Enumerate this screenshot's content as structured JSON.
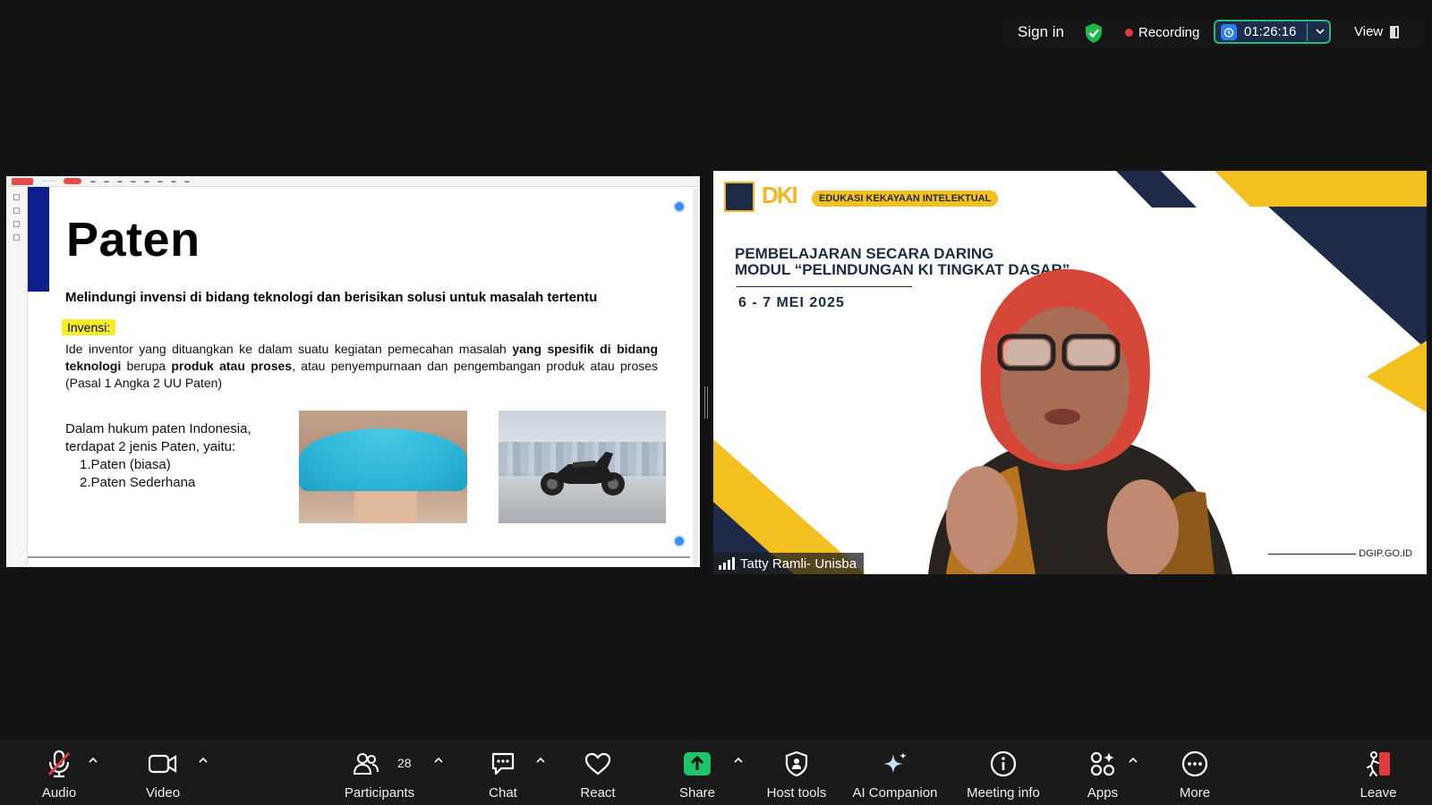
{
  "top_bar": {
    "sign_in": "Sign in",
    "recording_label": "Recording",
    "timer": "01:26:16",
    "view_label": "View"
  },
  "shared_slide": {
    "title": "Paten",
    "subtitle": "Melindungi invensi di bidang teknologi dan berisikan solusi untuk masalah tertentu",
    "highlight_label": "Invensi:",
    "paragraph_parts": [
      "Ide inventor yang dituangkan ke dalam suatu kegiatan pemecahan masalah ",
      "yang spesifik di bidang teknologi",
      " berupa ",
      "produk atau proses",
      ", atau penyempurnaan dan pengembangan produk atau proses (Pasal 1 Angka 2 UU Paten)"
    ],
    "list_intro": "Dalam hukum paten Indonesia, terdapat 2 jenis Paten, yaitu:",
    "list_items": [
      "1.Paten (biasa)",
      "2.Paten Sederhana"
    ]
  },
  "video": {
    "badge": "EDUKASI KEKAYAAN INTELEKTUAL",
    "logo_text": "DKI",
    "heading_line1": "PEMBELAJARAN SECARA DARING",
    "heading_line2": "MODUL “PELINDUNGAN KI TINGKAT DASAR”",
    "date": "6 - 7 MEI 2025",
    "site": "DGIP.GO.ID",
    "participant_name": "Tatty Ramli- Unisba"
  },
  "toolbar": {
    "audio": "Audio",
    "video": "Video",
    "participants": "Participants",
    "participants_count": "28",
    "chat": "Chat",
    "react": "React",
    "share": "Share",
    "host_tools": "Host tools",
    "ai_companion": "AI Companion",
    "meeting_info": "Meeting info",
    "apps": "Apps",
    "more": "More",
    "leave": "Leave"
  },
  "colors": {
    "background": "#131313",
    "share_green": "#1dc46a",
    "recording_red": "#e23b3b",
    "leave_red": "#e23b3b",
    "slide_navy": "#0d1f8c",
    "brand_yellow": "#f4c020",
    "brand_navy": "#1d2a4a"
  },
  "icons": [
    "shield-check-icon",
    "recording-dot-icon",
    "timer-icon",
    "chevron-down-icon",
    "view-layout-icon",
    "microphone-muted-icon",
    "video-camera-icon",
    "participants-icon",
    "chat-icon",
    "heart-icon",
    "share-arrow-icon",
    "host-shield-icon",
    "sparkle-icon",
    "info-icon",
    "apps-icon",
    "more-dots-icon",
    "leave-icon"
  ]
}
